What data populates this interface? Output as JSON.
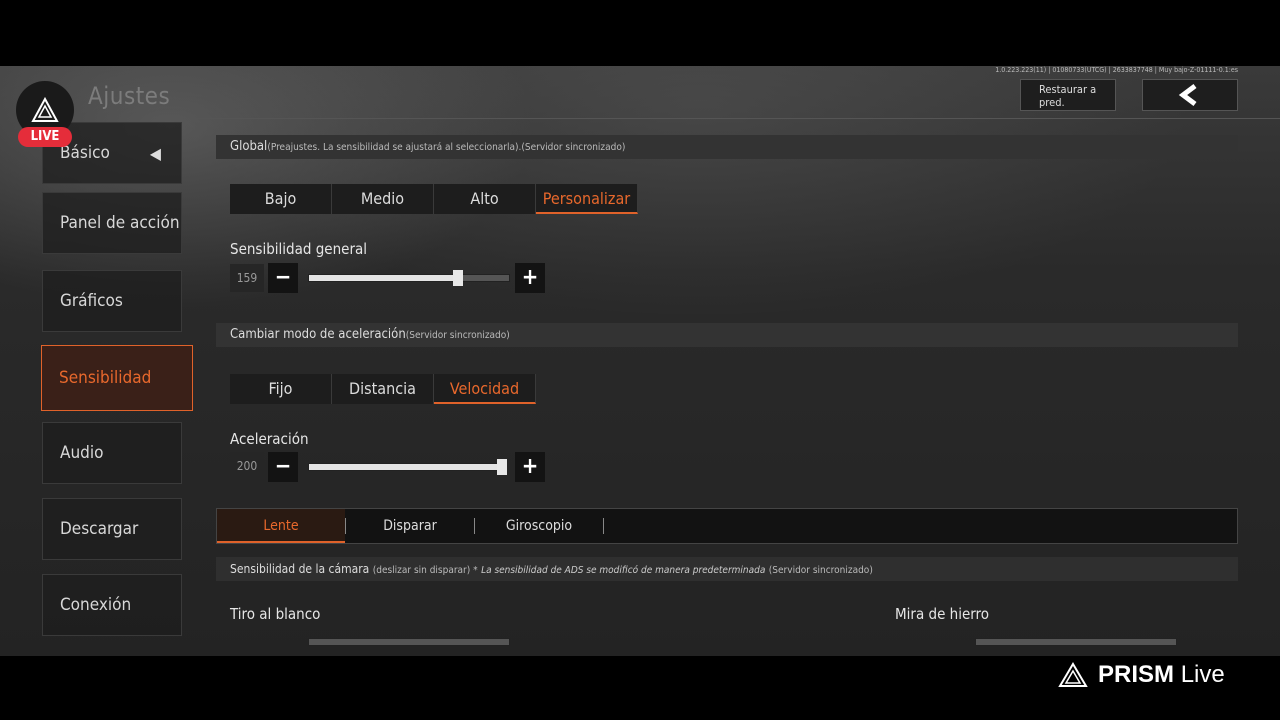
{
  "header": {
    "title": "Ajustes",
    "version_info": "1.0.223.223(11) | 01080733(UTCG) | 2633837748 | Muy bajo-Z-01111-0.1:es",
    "restore_label": "Restaurar a pred.",
    "back_icon": "chevron-left-icon"
  },
  "live_badge": {
    "label": "LIVE",
    "color": "#e52d3a"
  },
  "sidebar": {
    "items": [
      {
        "label": "Básico"
      },
      {
        "label": "Panel de acción"
      },
      {
        "label": "Gráficos"
      },
      {
        "label": "Sensibilidad"
      },
      {
        "label": "Audio"
      },
      {
        "label": "Descargar"
      },
      {
        "label": "Conexión"
      }
    ],
    "active": "Sensibilidad"
  },
  "global": {
    "title": "Global",
    "note": "(Preajustes. La sensibilidad se ajustará al seleccionarla).(Servidor sincronizado)",
    "presets": [
      "Bajo",
      "Medio",
      "Alto",
      "Personalizar"
    ],
    "selected": "Personalizar"
  },
  "general_sensitivity": {
    "label": "Sensibilidad general",
    "value": "159",
    "fraction": 0.76
  },
  "acceleration_mode": {
    "title": "Cambiar modo de aceleración",
    "note": "(Servidor sincronizado)",
    "options": [
      "Fijo",
      "Distancia",
      "Velocidad"
    ],
    "selected": "Velocidad"
  },
  "acceleration": {
    "label": "Aceleración",
    "value": "200",
    "fraction": 1.0
  },
  "tabs": {
    "items": [
      "Lente",
      "Disparar",
      "Giroscopio"
    ],
    "selected": "Lente"
  },
  "camera": {
    "title": "Sensibilidad de la cámara",
    "note1": "(deslizar sin disparar) *",
    "note2": "La sensibilidad de ADS se modificó de manera predeterminada",
    "note3": "(Servidor sincronizado)",
    "left_label": "Tiro al blanco",
    "right_label": "Mira de hierro"
  },
  "overlay": {
    "brand_bold": "PRISM",
    "brand_light": "Live"
  },
  "accent_color": "#e8682c"
}
